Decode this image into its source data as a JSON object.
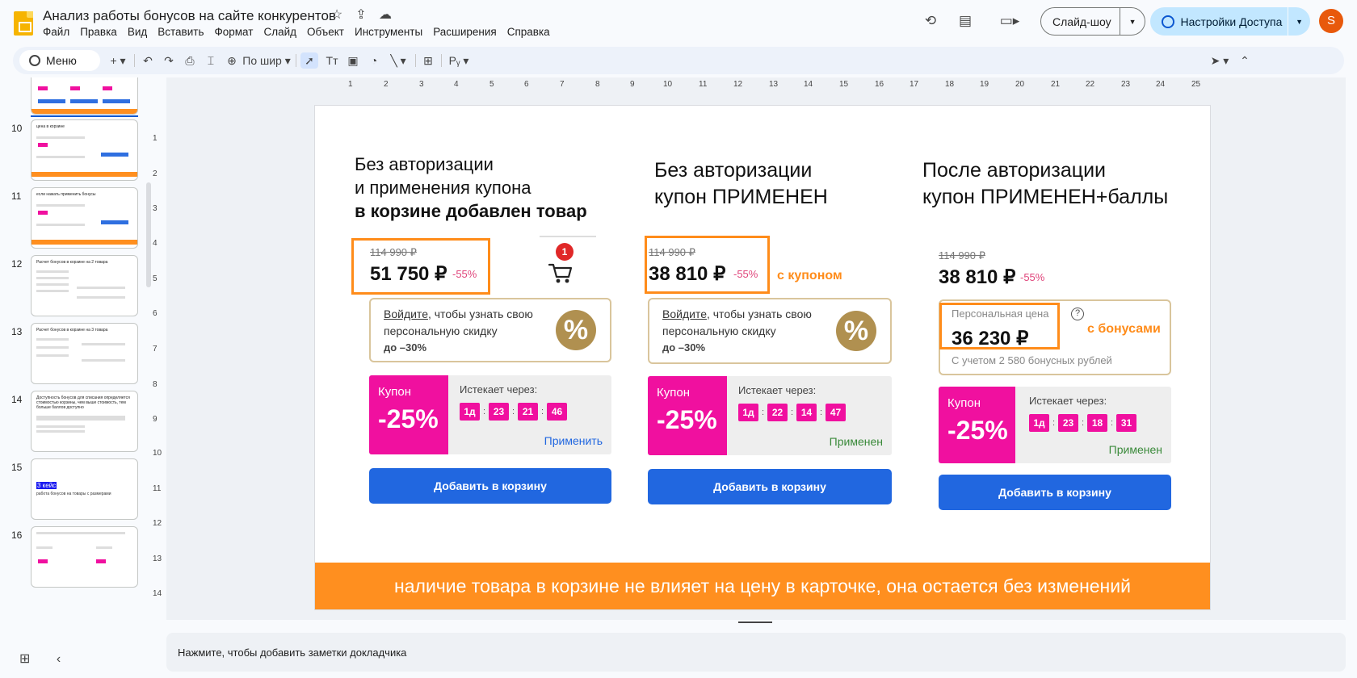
{
  "doc": {
    "title": "Анализ работы бонусов на сайте конкурентов",
    "title_icons": [
      "star-icon",
      "move-to-drive-icon",
      "cloud-icon"
    ]
  },
  "menu": [
    "Файл",
    "Правка",
    "Вид",
    "Вставить",
    "Формат",
    "Слайд",
    "Объект",
    "Инструменты",
    "Расширения",
    "Справка"
  ],
  "header_right": {
    "slideshow_label": "Слайд-шоу",
    "share_label": "Настройки Доступа",
    "avatar_letter": "S",
    "avatar_color": "#e8590c"
  },
  "toolbar": {
    "search_label": "Меню",
    "zoom_label": "По шир"
  },
  "filmstrip": [
    {
      "num": "",
      "title": ""
    },
    {
      "num": "10",
      "title": "цена в корзине"
    },
    {
      "num": "11",
      "title": "если нажать применить бонусы"
    },
    {
      "num": "12",
      "title": "Расчет бонусов в корзине на 2 товара"
    },
    {
      "num": "13",
      "title": "Расчет бонусов в корзине на 3 товара"
    },
    {
      "num": "14",
      "title": "Доступность бонусов для списания определяется стоимостью корзины, чем выше стоимость, тем больше баллов доступно"
    },
    {
      "num": "15",
      "title": "3 кейс",
      "subtitle": "работа бонусов на товары с размерами"
    },
    {
      "num": "16",
      "title": ""
    }
  ],
  "ruler": {
    "h": [
      "1",
      "2",
      "3",
      "4",
      "5",
      "6",
      "7",
      "8",
      "9",
      "10",
      "11",
      "12",
      "13",
      "14",
      "15",
      "16",
      "17",
      "18",
      "19",
      "20",
      "21",
      "22",
      "23",
      "24",
      "25"
    ],
    "v": [
      "1",
      "2",
      "3",
      "4",
      "5",
      "6",
      "7",
      "8",
      "9",
      "10",
      "11",
      "12",
      "13",
      "14"
    ]
  },
  "slide": {
    "col1": {
      "line1": "Без авторизации",
      "line2": "и применения купона",
      "line3": "в корзине добавлен товар",
      "old_price": "114 990 ₽",
      "new_price": "51 750 ₽",
      "discount": "-55%",
      "cart_count": "1",
      "login_link": "Войдите",
      "login_text": ", чтобы узнать свою персональную скидку",
      "login_sub": "до –30%",
      "coupon_label": "Купон",
      "coupon_value": "-25%",
      "expires": "Истекает через:",
      "timer": [
        "1д",
        "23",
        "21",
        "46"
      ],
      "apply": "Применить",
      "cart_button": "Добавить в корзину"
    },
    "col2": {
      "line1": "Без авторизации",
      "line2": "купон ПРИМЕНЕН",
      "old_price": "114 990 ₽",
      "new_price": "38 810 ₽",
      "discount": "-55%",
      "note": "с купоном",
      "login_link": "Войдите",
      "login_text": ", чтобы узнать свою персональную скидку",
      "login_sub": "до –30%",
      "coupon_label": "Купон",
      "coupon_value": "-25%",
      "expires": "Истекает через:",
      "timer": [
        "1д",
        "22",
        "14",
        "47"
      ],
      "apply": "Применен",
      "cart_button": "Добавить в корзину"
    },
    "col3": {
      "line1": "После авторизации",
      "line2": "купон ПРИМЕНЕН+баллы",
      "old_price": "114 990 ₽",
      "new_price": "38 810 ₽",
      "discount": "-55%",
      "personal_label": "Персональная цена",
      "personal_value": "36 230 ₽",
      "personal_note": "С учетом 2 580 бонусных рублей",
      "note": "с бонусами",
      "coupon_label": "Купон",
      "coupon_value": "-25%",
      "expires": "Истекает через:",
      "timer": [
        "1д",
        "23",
        "18",
        "31"
      ],
      "apply": "Применен",
      "cart_button": "Добавить в корзину"
    },
    "bottom_bar": "наличие товара в корзине не влияет на цену в карточке, она остается без изменений"
  },
  "notes_placeholder": "Нажмите, чтобы добавить заметки докладчика",
  "colors": {
    "accent_orange": "#ff8f1f",
    "coupon_pink": "#f0109f",
    "button_blue": "#2167e0",
    "applied_green": "#3a8a3a",
    "apply_blue": "#2167e0"
  }
}
